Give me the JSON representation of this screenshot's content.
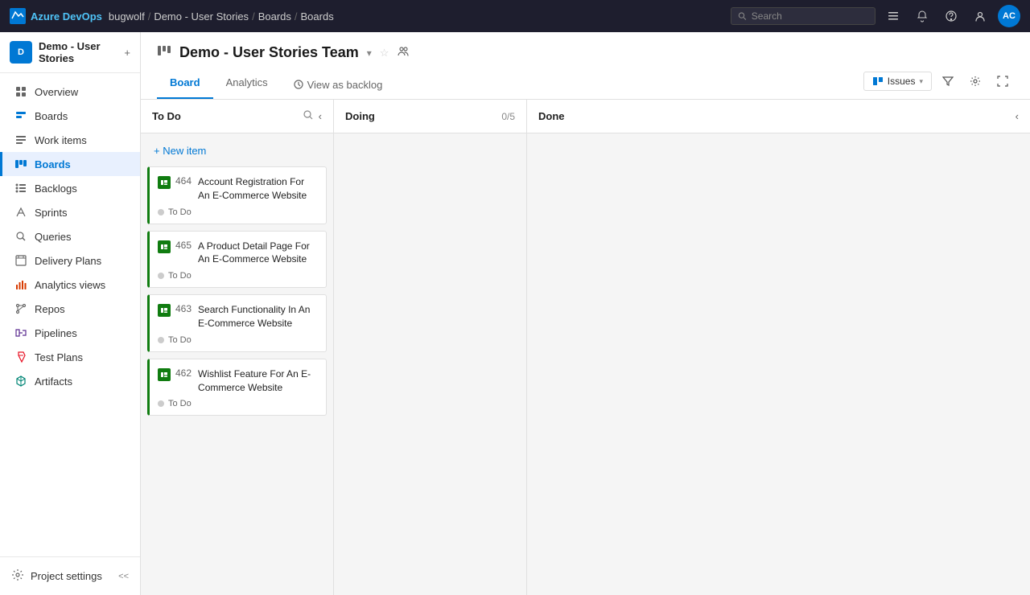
{
  "topbar": {
    "logo_text": "Azure DevOps",
    "breadcrumb": [
      "bugwolf",
      "Demo - User Stories",
      "Boards",
      "Boards"
    ],
    "search_placeholder": "Search",
    "avatar_initials": "AC"
  },
  "sidebar": {
    "project_name": "Demo - User Stories",
    "items": [
      {
        "id": "overview",
        "label": "Overview",
        "icon": "overview"
      },
      {
        "id": "boards-top",
        "label": "Boards",
        "icon": "boards"
      },
      {
        "id": "work-items",
        "label": "Work items",
        "icon": "work-items"
      },
      {
        "id": "boards",
        "label": "Boards",
        "icon": "boards",
        "active": true
      },
      {
        "id": "backlogs",
        "label": "Backlogs",
        "icon": "backlogs"
      },
      {
        "id": "sprints",
        "label": "Sprints",
        "icon": "sprints"
      },
      {
        "id": "queries",
        "label": "Queries",
        "icon": "queries"
      },
      {
        "id": "delivery-plans",
        "label": "Delivery Plans",
        "icon": "delivery"
      },
      {
        "id": "analytics-views",
        "label": "Analytics views",
        "icon": "analytics"
      },
      {
        "id": "repos",
        "label": "Repos",
        "icon": "repos"
      },
      {
        "id": "pipelines",
        "label": "Pipelines",
        "icon": "pipelines"
      },
      {
        "id": "test-plans",
        "label": "Test Plans",
        "icon": "test"
      },
      {
        "id": "artifacts",
        "label": "Artifacts",
        "icon": "artifacts"
      }
    ],
    "footer": {
      "label": "Project settings",
      "collapse_label": "<<"
    }
  },
  "board": {
    "title": "Demo - User Stories Team",
    "tabs": [
      {
        "id": "board",
        "label": "Board",
        "active": true
      },
      {
        "id": "analytics",
        "label": "Analytics",
        "active": false
      }
    ],
    "view_backlog_label": "View as backlog",
    "toolbar": {
      "issues_label": "Issues",
      "filter_icon": "filter",
      "settings_icon": "settings",
      "fullscreen_icon": "fullscreen"
    },
    "columns": [
      {
        "id": "todo",
        "title": "To Do",
        "count": "",
        "show_count": false,
        "cards": [
          {
            "id": "464",
            "title": "Account Registration For An E-Commerce Website",
            "status": "To Do"
          },
          {
            "id": "465",
            "title": "A Product Detail Page For An E-Commerce Website",
            "status": "To Do"
          },
          {
            "id": "463",
            "title": "Search Functionality In An E-Commerce Website",
            "status": "To Do"
          },
          {
            "id": "462",
            "title": "Wishlist Feature For An E-Commerce Website",
            "status": "To Do"
          }
        ]
      },
      {
        "id": "doing",
        "title": "Doing",
        "count": "0/5",
        "show_count": true,
        "cards": []
      },
      {
        "id": "done",
        "title": "Done",
        "count": "",
        "show_count": false,
        "cards": []
      }
    ],
    "new_item_label": "+ New item",
    "status_todo": "To Do"
  }
}
